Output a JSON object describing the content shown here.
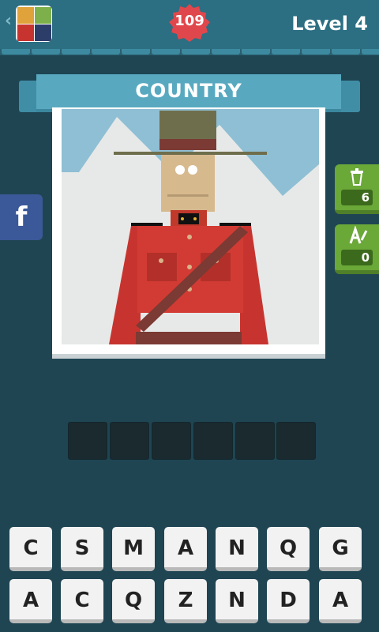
{
  "header": {
    "back_icon": "chevron-left-icon",
    "coins": "109",
    "level": "Level 4"
  },
  "puzzle": {
    "category": "COUNTRY"
  },
  "hints": {
    "remove_letters_count": "6",
    "reveal_letter_count": "0"
  },
  "social": {
    "facebook_label": "f"
  },
  "answer": {
    "slots": [
      "",
      "",
      "",
      "",
      "",
      ""
    ]
  },
  "keyboard": {
    "row1": [
      "C",
      "S",
      "M",
      "A",
      "N",
      "Q",
      "G"
    ],
    "row2": [
      "A",
      "C",
      "Q",
      "Z",
      "N",
      "D",
      "A"
    ]
  }
}
